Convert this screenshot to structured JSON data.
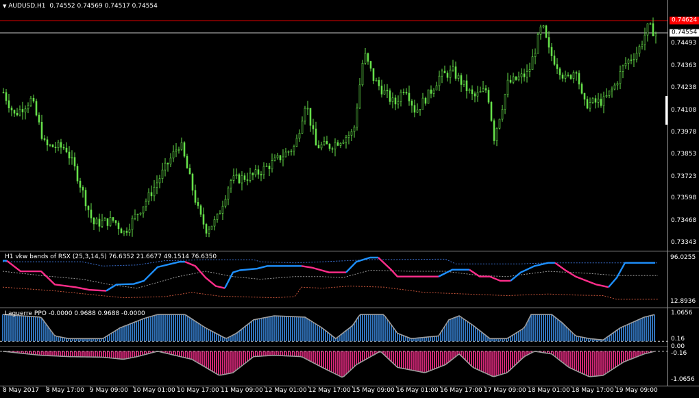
{
  "symbol": {
    "name": "AUDUSD,H1",
    "ohlc": "0.74552 0.74569 0.74517 0.74554"
  },
  "price_axis": {
    "ticks": [
      "0.74493",
      "0.74363",
      "0.74238",
      "0.74108",
      "0.73978",
      "0.73853",
      "0.73723",
      "0.73598",
      "0.73468",
      "0.73343"
    ],
    "red_line_value": "0.74624",
    "current_value": "0.74554",
    "min": 0.7331,
    "max": 0.74665
  },
  "rsx": {
    "title": "H1 vkw bands of RSX (25,3,14,5) 76.6352 21.6677 49.1514 76.6350",
    "axis_top": "96.0255",
    "axis_bottom": "12.8936"
  },
  "ppo": {
    "title": "Laguerre PPO -0.0000 0.9688 0.9688 -0.0000",
    "ticks": [
      "1.0656",
      "0.16",
      "0.00",
      "-0.16",
      "-1.0656"
    ]
  },
  "time_axis": [
    "8 May 2017",
    "8 May 17:00",
    "9 May 09:00",
    "10 May 01:00",
    "10 May 17:00",
    "11 May 09:00",
    "12 May 01:00",
    "12 May 17:00",
    "15 May 09:00",
    "16 May 01:00",
    "16 May 17:00",
    "17 May 09:00",
    "18 May 01:00",
    "18 May 17:00",
    "19 May 09:00"
  ],
  "colors": {
    "background": "#000000",
    "bull_candle": "#66e04a",
    "red_line": "#ff0000",
    "rsx_up": "#1e90ff",
    "rsx_down": "#ff2d8a",
    "ppo_positive": "#3d8ee6",
    "ppo_negative": "#ff2f90",
    "ppo_outline": "#9c9c9c"
  }
}
